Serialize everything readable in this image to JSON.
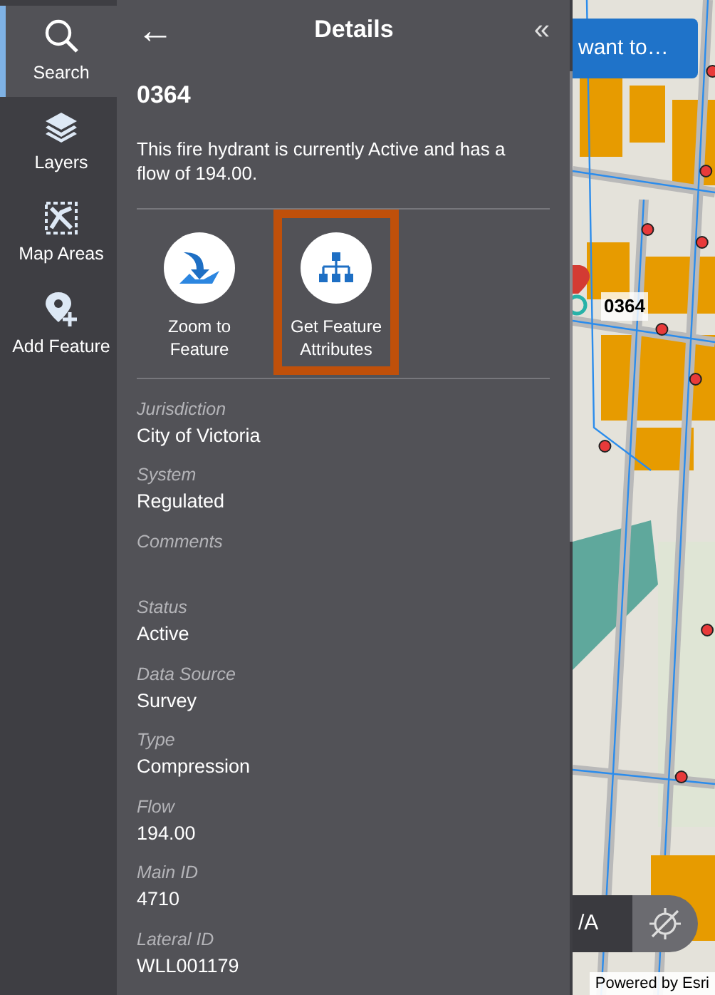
{
  "sidebar": {
    "items": [
      {
        "label": "Search",
        "kind": "search",
        "selected": true
      },
      {
        "label": "Layers",
        "kind": "layers",
        "selected": false
      },
      {
        "label": "Map Areas",
        "kind": "areas",
        "selected": false
      },
      {
        "label": "Add Feature",
        "kind": "add",
        "selected": false
      }
    ]
  },
  "panel": {
    "back": "←",
    "title": "Details",
    "collapse": "«",
    "feature_title": "0364",
    "description": "This fire hydrant is currently Active and has a flow of 194.00.",
    "actions": [
      {
        "label": "Zoom to Feature",
        "kind": "zoom",
        "selected": false
      },
      {
        "label": "Get Feature Attributes",
        "kind": "tree",
        "selected": true
      }
    ],
    "fields": [
      {
        "label": "Jurisdiction",
        "value": "City of Victoria"
      },
      {
        "label": "System",
        "value": "Regulated"
      },
      {
        "label": "Comments"
      },
      {
        "label": "Status",
        "value": "Active"
      },
      {
        "label": "Data Source",
        "value": "Survey"
      },
      {
        "label": "Type",
        "value": "Compression"
      },
      {
        "label": "Flow",
        "value": "194.00"
      },
      {
        "label": "Main ID",
        "value": "4710"
      },
      {
        "label": "Lateral ID",
        "value": "WLL001179"
      }
    ]
  },
  "map": {
    "menu_button": "want to…",
    "feature_label": "0364",
    "bottom_button": "/A",
    "attribution": "Powered by Esri"
  }
}
